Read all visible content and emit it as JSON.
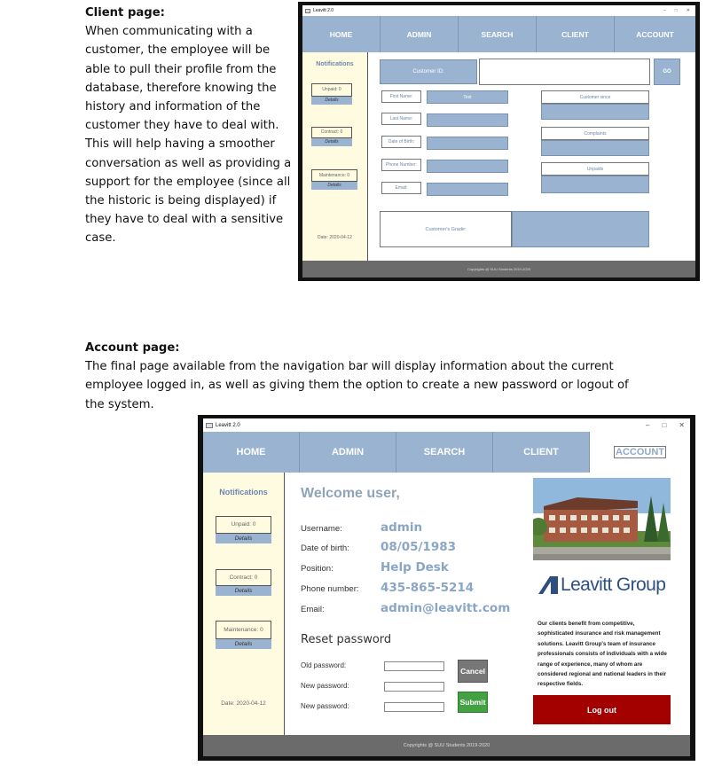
{
  "client_section": {
    "heading": "Client page:",
    "lines": [
      "When communicating with a",
      "customer, the employee will be",
      "able to pull their profile from the",
      "database, therefore knowing the",
      "history and information of the",
      "customer they have to deal with.",
      "This will help having a smoother",
      "conversation as well as providing a",
      "support for the employee (since all",
      "the historic is being displayed) if",
      "they have to deal with a sensitive",
      "case."
    ]
  },
  "account_section": {
    "heading": "Account page:",
    "lines": [
      "The final page available from the navigation bar will display information about the current",
      "employee logged in, as well as giving them the option to create a new password or logout of",
      "the system."
    ]
  },
  "app": {
    "title": "Leavitt 2.0",
    "window_controls": [
      "–",
      "□",
      "✕"
    ],
    "nav": [
      "HOME",
      "ADMIN",
      "SEARCH",
      "CLIENT",
      "ACCOUNT"
    ],
    "sidebar": {
      "notifications": "Notifications",
      "unpaid": "Unpaid: 0",
      "contract": "Contract: 0",
      "maintenance": "Maintenance: 0",
      "details": "Details",
      "date": "Date: 2020-04-12"
    },
    "footer": "Copyrights @ SUU Students 2019-2020"
  },
  "client_page": {
    "customer_id_label": "Customer ID:",
    "go_button": "GO",
    "first_name_label": "First Name:",
    "first_name_value": "Test",
    "last_name_label": "Last Name:",
    "dob_label": "Date of Birth:",
    "phone_label": "Phone Number:",
    "email_label": "Email:",
    "customer_since_label": "Customer since",
    "complaints_label": "Complaints",
    "unpaids_label": "Unpaids",
    "grade_label": "Customer's Grade:"
  },
  "account_page": {
    "welcome": "Welcome user,",
    "username_label": "Username:",
    "username_value": "admin",
    "dob_label": "Date of birth:",
    "dob_value": "08/05/1983",
    "position_label": "Position:",
    "position_value": "Help Desk",
    "phone_label": "Phone number:",
    "phone_value": "435-865-5214",
    "email_label": "Email:",
    "email_value": "admin@leavitt.com",
    "reset_heading": "Reset password",
    "old_pw_label": "Old password:",
    "new_pw_label": "New password:",
    "new_pw2_label": "New password:",
    "cancel_button": "Cancel",
    "submit_button": "Submit",
    "logo_text": "Leavitt Group",
    "about_lines": [
      "Our clients benefit from competitive,",
      "sophisticated insurance and risk management",
      "solutions. Leavitt Group's team of insurance",
      "professionals consists of individuals with a wide",
      "range of experience, many of whom are",
      "considered regional and national leaders in their",
      "respective fields."
    ],
    "logout_button": "Log out"
  },
  "colors": {
    "nav_blue": "#9ab3d1",
    "sidebar_cream": "#fffbe0",
    "footer_gray": "#6b6b6b",
    "cancel_gray": "#777777",
    "submit_green": "#43a043",
    "logout_red": "#a30000"
  }
}
